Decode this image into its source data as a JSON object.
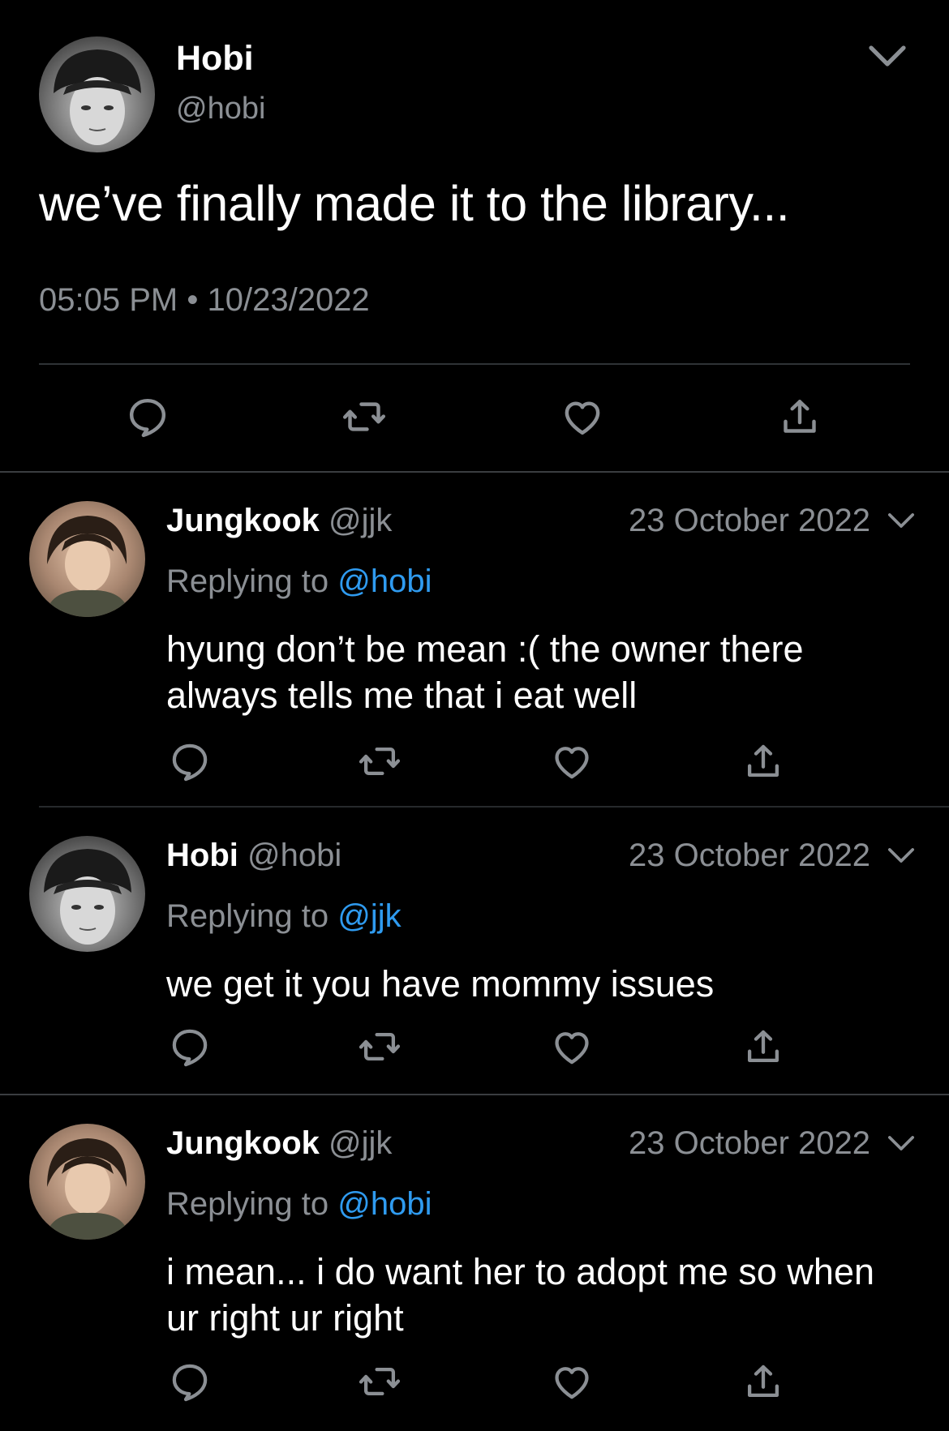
{
  "main_tweet": {
    "name": "Hobi",
    "handle": "@hobi",
    "text": "we’ve finally made it to the library...",
    "time": "05:05 PM",
    "separator": "•",
    "date": "10/23/2022"
  },
  "replies": [
    {
      "name": "Jungkook",
      "handle": "@jjk",
      "date": "23 October 2022",
      "replying_prefix": "Replying to",
      "replying_to": "@hobi",
      "text": "hyung don’t be mean :( the owner there always tells me that i eat well"
    },
    {
      "name": "Hobi",
      "handle": "@hobi",
      "date": "23 October 2022",
      "replying_prefix": "Replying to",
      "replying_to": "@jjk",
      "text": "we get it you have mommy issues"
    },
    {
      "name": "Jungkook",
      "handle": "@jjk",
      "date": "23 October 2022",
      "replying_prefix": "Replying to",
      "replying_to": "@hobi",
      "text": "i mean... i do want her to adopt me so when ur right ur right"
    }
  ],
  "icons": {
    "reply": "speech-bubble-icon",
    "retweet": "retweet-icon",
    "like": "heart-icon",
    "share": "share-icon",
    "menu": "chevron-down-icon"
  },
  "colors": {
    "background": "#000000",
    "text": "#ffffff",
    "muted": "#8b8f94",
    "link": "#2f9bf0",
    "divider": "#2f3336"
  }
}
